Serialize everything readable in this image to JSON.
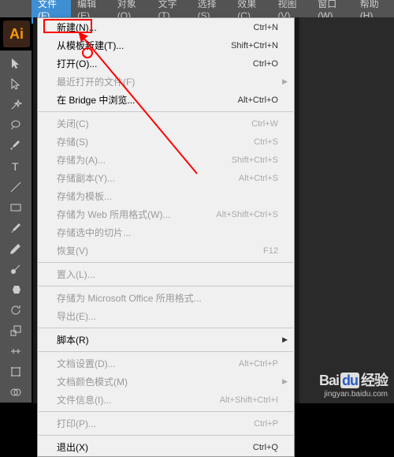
{
  "menubar": {
    "items": [
      {
        "label": "文件(F)",
        "active": true
      },
      {
        "label": "编辑(E)"
      },
      {
        "label": "对象(O)"
      },
      {
        "label": "文字(T)"
      },
      {
        "label": "选择(S)"
      },
      {
        "label": "效果(C)"
      },
      {
        "label": "视图(V)"
      },
      {
        "label": "窗口(W)"
      },
      {
        "label": "帮助(H)"
      }
    ]
  },
  "appIcon": "Ai",
  "fileMenu": {
    "groups": [
      [
        {
          "label": "新建(N)...",
          "shortcut": "Ctrl+N",
          "enabled": true
        },
        {
          "label": "从模板新建(T)...",
          "shortcut": "Shift+Ctrl+N",
          "enabled": true
        },
        {
          "label": "打开(O)...",
          "shortcut": "Ctrl+O",
          "enabled": true
        },
        {
          "label": "最近打开的文件(F)",
          "shortcut": "",
          "enabled": false,
          "submenu": true
        },
        {
          "label": "在 Bridge 中浏览...",
          "shortcut": "Alt+Ctrl+O",
          "enabled": true
        }
      ],
      [
        {
          "label": "关闭(C)",
          "shortcut": "Ctrl+W",
          "enabled": false
        },
        {
          "label": "存储(S)",
          "shortcut": "Ctrl+S",
          "enabled": false
        },
        {
          "label": "存储为(A)...",
          "shortcut": "Shift+Ctrl+S",
          "enabled": false
        },
        {
          "label": "存储副本(Y)...",
          "shortcut": "Alt+Ctrl+S",
          "enabled": false
        },
        {
          "label": "存储为模板...",
          "shortcut": "",
          "enabled": false
        },
        {
          "label": "存储为 Web 所用格式(W)...",
          "shortcut": "Alt+Shift+Ctrl+S",
          "enabled": false
        },
        {
          "label": "存储选中的切片...",
          "shortcut": "",
          "enabled": false
        },
        {
          "label": "恢复(V)",
          "shortcut": "F12",
          "enabled": false
        }
      ],
      [
        {
          "label": "置入(L)...",
          "shortcut": "",
          "enabled": false
        }
      ],
      [
        {
          "label": "存储为 Microsoft Office 所用格式...",
          "shortcut": "",
          "enabled": false
        },
        {
          "label": "导出(E)...",
          "shortcut": "",
          "enabled": false
        }
      ],
      [
        {
          "label": "脚本(R)",
          "shortcut": "",
          "enabled": true,
          "submenu": true
        }
      ],
      [
        {
          "label": "文档设置(D)...",
          "shortcut": "Alt+Ctrl+P",
          "enabled": false
        },
        {
          "label": "文档颜色模式(M)",
          "shortcut": "",
          "enabled": false,
          "submenu": true
        },
        {
          "label": "文件信息(I)...",
          "shortcut": "Alt+Shift+Ctrl+I",
          "enabled": false
        }
      ],
      [
        {
          "label": "打印(P)...",
          "shortcut": "Ctrl+P",
          "enabled": false
        }
      ],
      [
        {
          "label": "退出(X)",
          "shortcut": "Ctrl+Q",
          "enabled": true
        }
      ]
    ]
  },
  "watermark": {
    "brand1": "Bai",
    "brand2": "du",
    "brand3": "经验",
    "url": "jingyan.baidu.com"
  }
}
